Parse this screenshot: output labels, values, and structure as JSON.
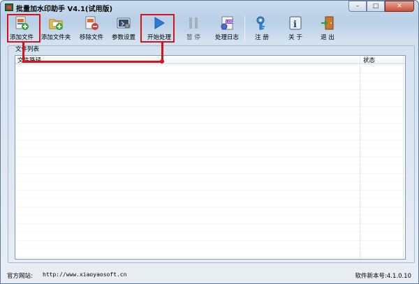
{
  "window": {
    "title": "批量加水印助手 V4.1(试用版)"
  },
  "window_controls": {
    "minimize": "–",
    "maximize": "□",
    "close": "✕"
  },
  "toolbar": {
    "add_file": "添加文件",
    "add_folder": "添加文件夹",
    "remove_file": "移除文件",
    "settings": "参数设置",
    "start": "开始处理",
    "pause": "暂 停",
    "log": "处理日志",
    "register": "注 册",
    "about": "关 于",
    "exit": "退 出"
  },
  "file_list": {
    "title": "文件列表",
    "columns": {
      "path": "文件路径",
      "status": "状态"
    }
  },
  "footer": {
    "site_label": "官方网站:",
    "site_url": "http://www.xiaoyaosoft.cn",
    "version": "软件新本号:4.1.0.10"
  },
  "colors": {
    "highlight": "#d6131b",
    "accent": "#2b7bd6"
  }
}
